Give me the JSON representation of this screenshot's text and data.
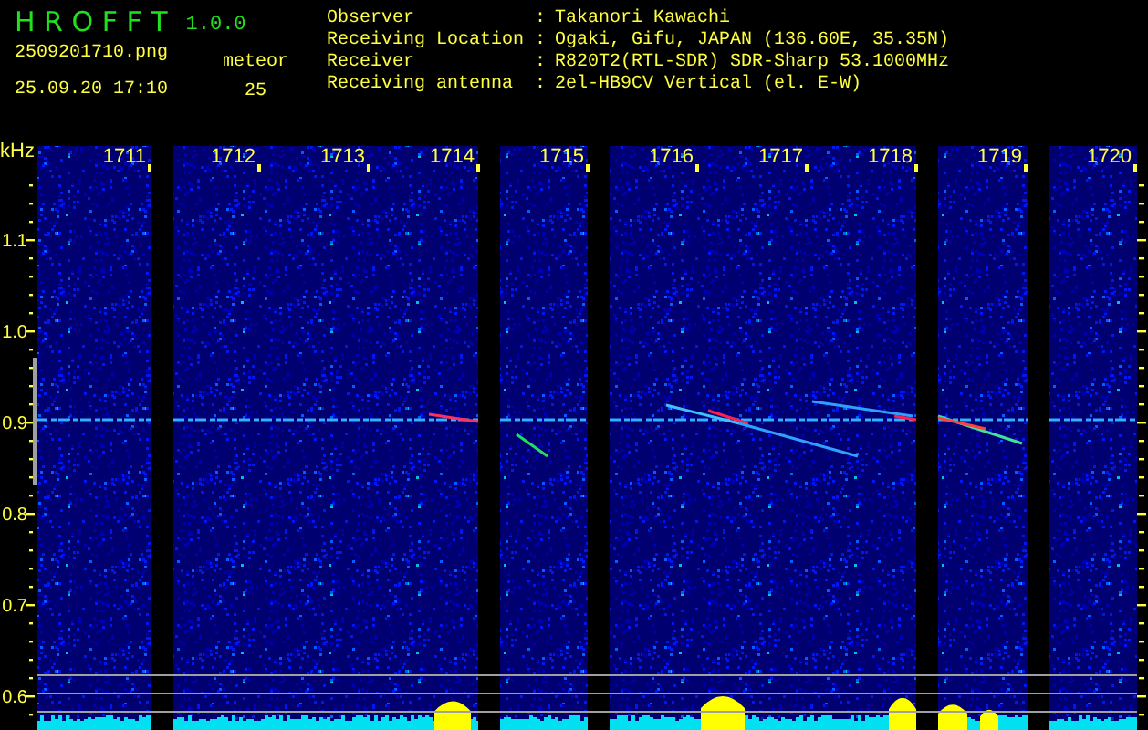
{
  "app": {
    "name": "H R O F F T",
    "version": "1.0.0"
  },
  "file": {
    "filename": "2509201710.png",
    "datetime": "25.09.20 17:10"
  },
  "meteor": {
    "label": "meteor",
    "count": "25"
  },
  "info": [
    {
      "label": "Observer",
      "colon": ":",
      "value": "Takanori Kawachi"
    },
    {
      "label": "Receiving Location",
      "colon": ":",
      "value": "Ogaki, Gifu, JAPAN (136.60E, 35.35N)"
    },
    {
      "label": "Receiver",
      "colon": ":",
      "value": "R820T2(RTL-SDR) SDR-Sharp 53.1000MHz"
    },
    {
      "label": "Receiving antenna",
      "colon": ":",
      "value": "2el-HB9CV Vertical (el. E-W)"
    }
  ],
  "spectrogram": {
    "unit": "kHz",
    "time_labels": [
      "1711",
      "1712",
      "1713",
      "1714",
      "1715",
      "1716",
      "1717",
      "1718",
      "1719",
      "1720"
    ],
    "frequency_labels": [
      "1.1",
      "1.0",
      "0.9",
      "0.8",
      "0.7",
      "0.6"
    ]
  }
}
